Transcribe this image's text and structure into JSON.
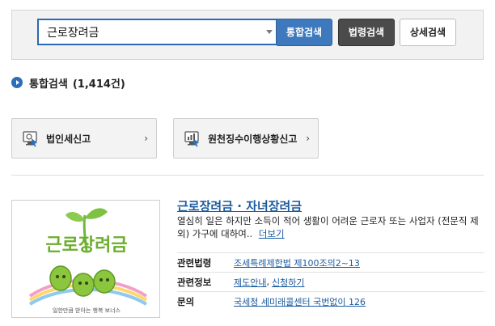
{
  "search": {
    "query": "근로장려금",
    "buttons": {
      "integrated": "통합검색",
      "law": "법령검색",
      "detail": "상세검색"
    }
  },
  "results": {
    "title": "통합검색",
    "count": "(1,414건)"
  },
  "quick_links": [
    {
      "label": "법인세신고",
      "icon": "monitor-cursor-icon"
    },
    {
      "label": "원천징수이행상황신고",
      "icon": "chart-cursor-icon"
    }
  ],
  "item": {
    "title": "근로장려금 · 자녀장려금",
    "description": "열심히 일은 하지만 소득이 적어 생활이 어려운 근로자 또는 사업자 (전문직 제외) 가구에 대하여..",
    "more_label": "더보기",
    "thumbnail": {
      "logo_text": "근로장려금",
      "tagline": "일한만큼 받아는 행복 보너스"
    },
    "info": {
      "law_label": "관련법령",
      "law_value": "조세특례제한법 제100조의2~13",
      "related_label": "관련정보",
      "related_values": [
        "제도안내",
        "신청하기"
      ],
      "contact_label": "문의",
      "contact_value": "국세청 세미래콜센터 국번없이 126"
    }
  },
  "colors": {
    "primary": "#3e79be",
    "dark_button": "#4b4b4b",
    "link": "#1b5a9e"
  }
}
